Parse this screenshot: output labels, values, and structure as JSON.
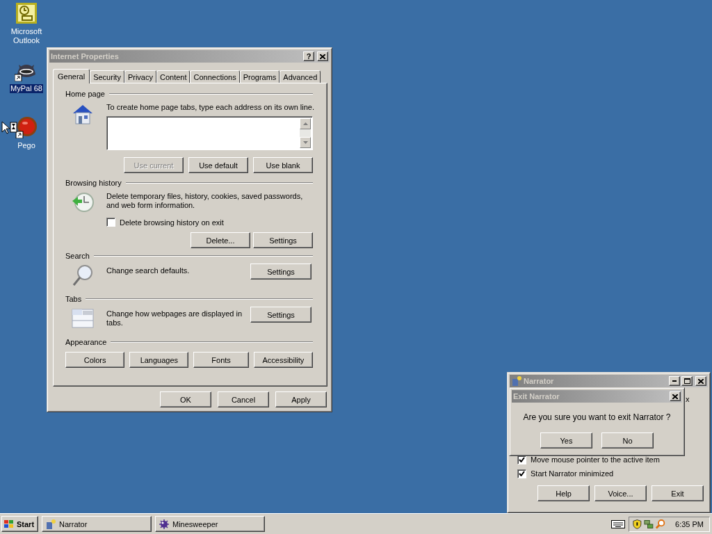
{
  "desktop_icons": [
    {
      "label": "Microsoft Outlook",
      "kind": "outlook",
      "selected": false
    },
    {
      "label": "MyPal 68",
      "kind": "raccoon",
      "selected": true
    },
    {
      "label": "Pego",
      "kind": "ball",
      "selected": false
    }
  ],
  "internet_properties": {
    "title": "Internet Properties",
    "help_button": "?",
    "tabs": [
      {
        "label": "General",
        "selected": true
      },
      {
        "label": "Security",
        "selected": false
      },
      {
        "label": "Privacy",
        "selected": false
      },
      {
        "label": "Content",
        "selected": false
      },
      {
        "label": "Connections",
        "selected": false
      },
      {
        "label": "Programs",
        "selected": false
      },
      {
        "label": "Advanced",
        "selected": false
      }
    ],
    "home_page": {
      "title": "Home page",
      "text": "To create home page tabs, type each address on its own line.",
      "buttons": [
        {
          "label": "Use current",
          "disabled": true
        },
        {
          "label": "Use default",
          "disabled": false
        },
        {
          "label": "Use blank",
          "disabled": false
        }
      ]
    },
    "browsing_history": {
      "title": "Browsing history",
      "text": "Delete temporary files, history, cookies, saved passwords, and web form information.",
      "checkbox": {
        "label": "Delete browsing history on exit",
        "checked": false
      },
      "buttons": [
        {
          "label": "Delete...",
          "disabled": false
        },
        {
          "label": "Settings",
          "disabled": false
        }
      ]
    },
    "search": {
      "title": "Search",
      "text": "Change search defaults.",
      "buttons": [
        {
          "label": "Settings",
          "disabled": false
        }
      ]
    },
    "tabs_section": {
      "title": "Tabs",
      "text": "Change how webpages are displayed in tabs.",
      "buttons": [
        {
          "label": "Settings",
          "disabled": false
        }
      ]
    },
    "appearance": {
      "title": "Appearance",
      "buttons": [
        {
          "label": "Colors",
          "disabled": false
        },
        {
          "label": "Languages",
          "disabled": false
        },
        {
          "label": "Fonts",
          "disabled": false
        },
        {
          "label": "Accessibility",
          "disabled": false
        }
      ]
    },
    "footer_buttons": [
      {
        "label": "OK",
        "disabled": false
      },
      {
        "label": "Cancel",
        "disabled": false
      },
      {
        "label": "Apply",
        "disabled": false
      }
    ]
  },
  "narrator": {
    "title": "Narrator",
    "hidden_fragment": "x",
    "checkboxes": [
      {
        "label": "Move mouse pointer to the active item",
        "checked": true
      },
      {
        "label": "Start Narrator minimized",
        "checked": true
      }
    ],
    "buttons": [
      {
        "label": "Help"
      },
      {
        "label": "Voice..."
      },
      {
        "label": "Exit"
      }
    ]
  },
  "exit_dialog": {
    "title": "Exit Narrator",
    "message": "Are you sure you want to exit Narrator ?",
    "buttons": [
      {
        "label": "Yes"
      },
      {
        "label": "No"
      }
    ]
  },
  "taskbar": {
    "start": "Start",
    "tasks": [
      {
        "label": "Narrator",
        "kind": "narrator"
      },
      {
        "label": "Minesweeper",
        "kind": "mine"
      }
    ],
    "clock": "6:35 PM"
  }
}
